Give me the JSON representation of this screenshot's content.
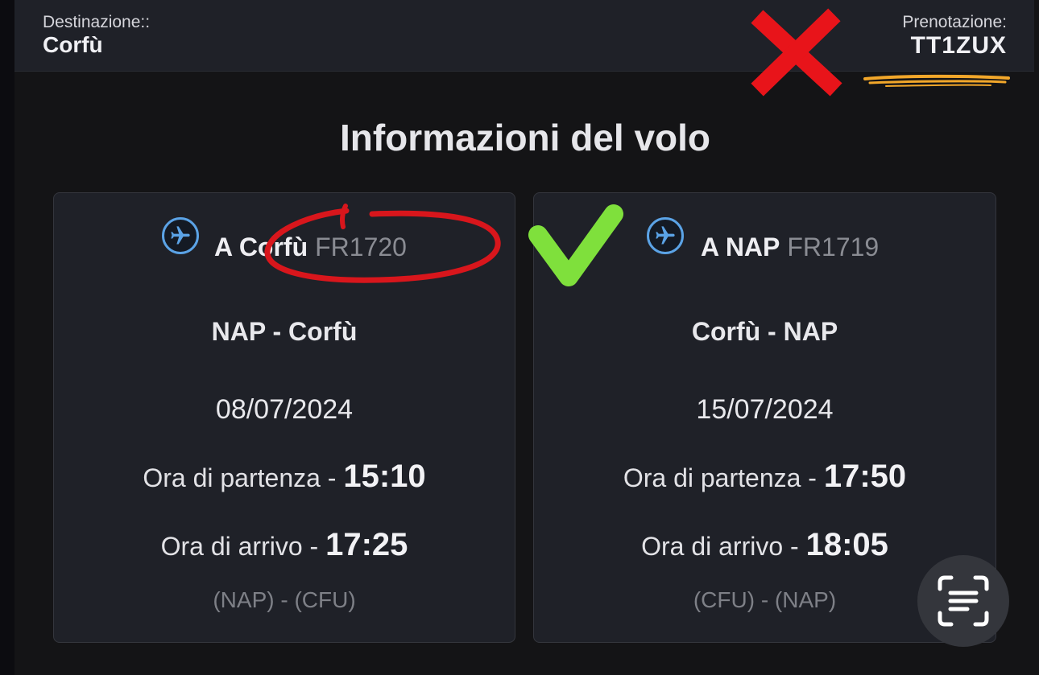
{
  "header": {
    "destination_label": "Destinazione::",
    "destination_value": "Corfù",
    "booking_label": "Prenotazione:",
    "booking_value": "TT1ZUX"
  },
  "title": "Informazioni del volo",
  "flights": [
    {
      "direction": "A Corfù",
      "flight_number": "FR1720",
      "route": "NAP - Corfù",
      "date": "08/07/2024",
      "departure_label": "Ora di partenza - ",
      "departure_time": "15:10",
      "arrival_label": "Ora di arrivo - ",
      "arrival_time": "17:25",
      "airport_codes": "(NAP) - (CFU)"
    },
    {
      "direction": "A NAP",
      "flight_number": "FR1719",
      "route": "Corfù - NAP",
      "date": "15/07/2024",
      "departure_label": "Ora di partenza - ",
      "departure_time": "17:50",
      "arrival_label": "Ora di arrivo - ",
      "arrival_time": "18:05",
      "airport_codes": "(CFU) - (NAP)"
    }
  ],
  "icons": {
    "flight": "airplane-icon",
    "scan": "text-scan-icon"
  },
  "annotations": {
    "cross_color": "#e8141a",
    "circle_color": "#d8161c",
    "check_color": "#7fe03c",
    "underline_color": "#f2a72a"
  }
}
